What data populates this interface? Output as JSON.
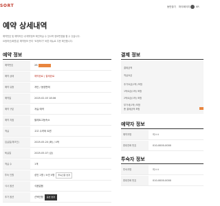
{
  "header": {
    "brand": "SORT",
    "link1": "동반찾기",
    "link2": "마이페이지",
    "user_name": "KR"
  },
  "page": {
    "title": "예약 상세내역",
    "desc1": "예약번호 및 예약하신 내 예약정보 확인하실 수 있으며 정보변경을 할 수 있습니다.",
    "desc2": "요청하신(회원)은 예약정보 관리 \"요청하기\" 버튼 메뉴로 주문 확인합니다."
  },
  "reservation": {
    "title": "예약 정보",
    "rows": [
      {
        "label": "예약번호",
        "value": "2B",
        "masked": true
      },
      {
        "label": "예약 상태",
        "value": "예약완료 | 결제완료",
        "red": true
      },
      {
        "label": "예약 유형",
        "value": "개인 / 동양판매"
      },
      {
        "label": "예약일",
        "value": "2025.02.03 18:06"
      },
      {
        "label": "예약 구분",
        "value": "개실 예약"
      },
      {
        "label": "예약 지점",
        "value": "팔레트고등속소"
      },
      {
        "label": "객실",
        "value": "고고 수려와 트윈"
      },
      {
        "label": "입실일(체크인)",
        "value": "2025.05.20 (화) / 4박"
      },
      {
        "label": "퇴실일",
        "value": "2025.05.07 (금)"
      },
      {
        "label": "객실 수",
        "value": "1객"
      },
      {
        "label": "투숙 인원",
        "value": "성인 2명 / 소인 0명",
        "button": "투숙인원 변경"
      },
      {
        "label": "식사 옵션",
        "value": "식음없음"
      },
      {
        "label": "추가 옵션",
        "value": "선택안함",
        "button": "옵션 변경",
        "button_dark": true
      }
    ]
  },
  "payment": {
    "title": "결제 정보",
    "items": [
      {
        "label": "결제금액",
        "value": ""
      },
      {
        "label": "객실요금",
        "value": ""
      },
      {
        "label": "추가요금(1박) 포함",
        "value": ""
      },
      {
        "label": "1박요금(1박) 포함",
        "value": ""
      },
      {
        "label": "2박요금(1박) 포함",
        "value": ""
      },
      {
        "label": "부가세(1박) 포함",
        "value": ""
      },
      {
        "label": "총 결제금액 포함",
        "value": ""
      }
    ]
  },
  "reserver": {
    "title": "예약자 정보",
    "rows": [
      {
        "label": "예약자명",
        "value": "이ㅇㅇ"
      },
      {
        "label": "휴대전화 번호",
        "value": "010-0000-0000"
      }
    ]
  },
  "guest": {
    "title": "투숙자 정보",
    "rows": [
      {
        "label": "투숙자명",
        "value": "이ㅇㅇ"
      },
      {
        "label": "휴대전화 번호",
        "value": "010-0000-0000"
      }
    ]
  }
}
